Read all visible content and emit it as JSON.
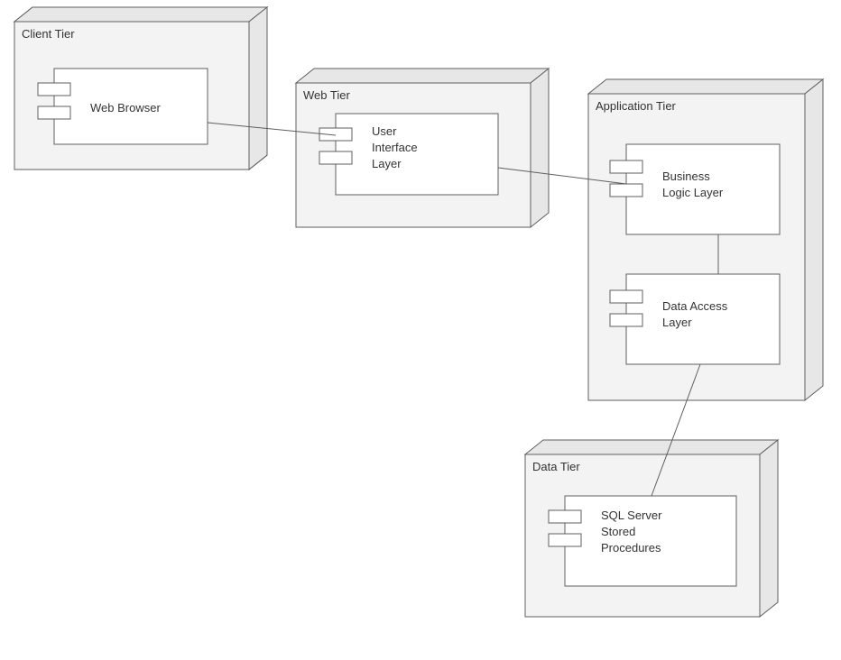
{
  "tiers": {
    "client": {
      "label": "Client Tier"
    },
    "web": {
      "label": "Web Tier"
    },
    "application": {
      "label": "Application Tier"
    },
    "data": {
      "label": "Data Tier"
    }
  },
  "components": {
    "webBrowser": {
      "lines": [
        "Web Browser"
      ]
    },
    "uiLayer": {
      "lines": [
        "User",
        "Interface",
        "Layer"
      ]
    },
    "businessLogic": {
      "lines": [
        "Business",
        "Logic Layer"
      ]
    },
    "dataAccess": {
      "lines": [
        "Data Access",
        "Layer"
      ]
    },
    "sqlServer": {
      "lines": [
        "SQL Server",
        "Stored",
        "Procedures"
      ]
    }
  }
}
